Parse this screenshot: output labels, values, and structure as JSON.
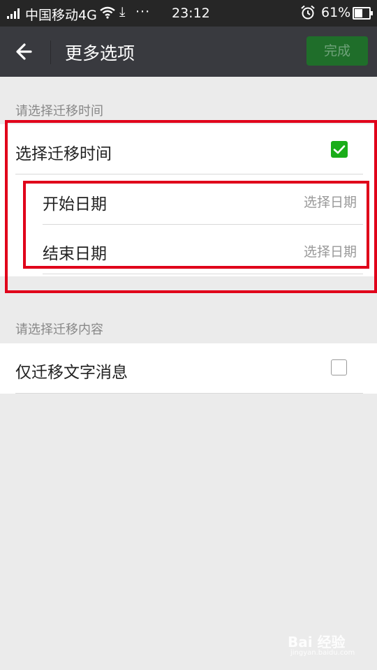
{
  "status_bar": {
    "carrier": "中国移动4G",
    "more": "···",
    "time": "23:12",
    "battery": "61%",
    "battery_level": 0.61
  },
  "action_bar": {
    "title": "更多选项",
    "done_label": "完成"
  },
  "time_section": {
    "header": "请选择迁移时间",
    "toggle_label": "选择迁移时间",
    "toggle_checked": true,
    "start_label": "开始日期",
    "start_hint": "选择日期",
    "end_label": "结束日期",
    "end_hint": "选择日期"
  },
  "content_section": {
    "header": "请选择迁移内容",
    "text_only_label": "仅迁移文字消息",
    "text_only_checked": false
  },
  "watermark": {
    "brand": "Bai 经验",
    "domain": "jingyan.baidu.com"
  },
  "colors": {
    "accent_green": "#1aad19",
    "annotation_red": "#e0001a",
    "action_bar": "#393a3f"
  }
}
